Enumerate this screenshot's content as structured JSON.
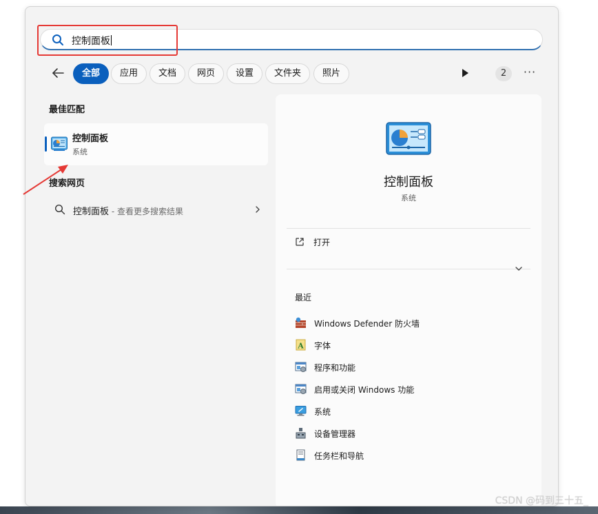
{
  "search": {
    "query": "控制面板"
  },
  "filters": {
    "tabs": [
      {
        "label": "全部",
        "active": true
      },
      {
        "label": "应用"
      },
      {
        "label": "文档"
      },
      {
        "label": "网页"
      },
      {
        "label": "设置"
      },
      {
        "label": "文件夹"
      },
      {
        "label": "照片"
      }
    ],
    "count_badge": "2"
  },
  "left": {
    "best_match_title": "最佳匹配",
    "best_match": {
      "title": "控制面板",
      "subtitle": "系统"
    },
    "web_title": "搜索网页",
    "web_result": {
      "query": "控制面板",
      "suffix": " - 查看更多搜索结果"
    }
  },
  "detail": {
    "name": "控制面板",
    "type": "系统",
    "open_label": "打开",
    "recent_title": "最近",
    "recent": [
      {
        "label": "Windows Defender 防火墙",
        "icon": "firewall-icon"
      },
      {
        "label": "字体",
        "icon": "font-icon"
      },
      {
        "label": "程序和功能",
        "icon": "programs-icon"
      },
      {
        "label": "启用或关闭 Windows 功能",
        "icon": "windows-features-icon"
      },
      {
        "label": "系统",
        "icon": "system-icon"
      },
      {
        "label": "设备管理器",
        "icon": "device-manager-icon"
      },
      {
        "label": "任务栏和导航",
        "icon": "taskbar-icon"
      }
    ]
  },
  "watermark": "CSDN @码到三十五_",
  "colors": {
    "accent": "#0a5fbd",
    "annotation": "#e53935"
  }
}
